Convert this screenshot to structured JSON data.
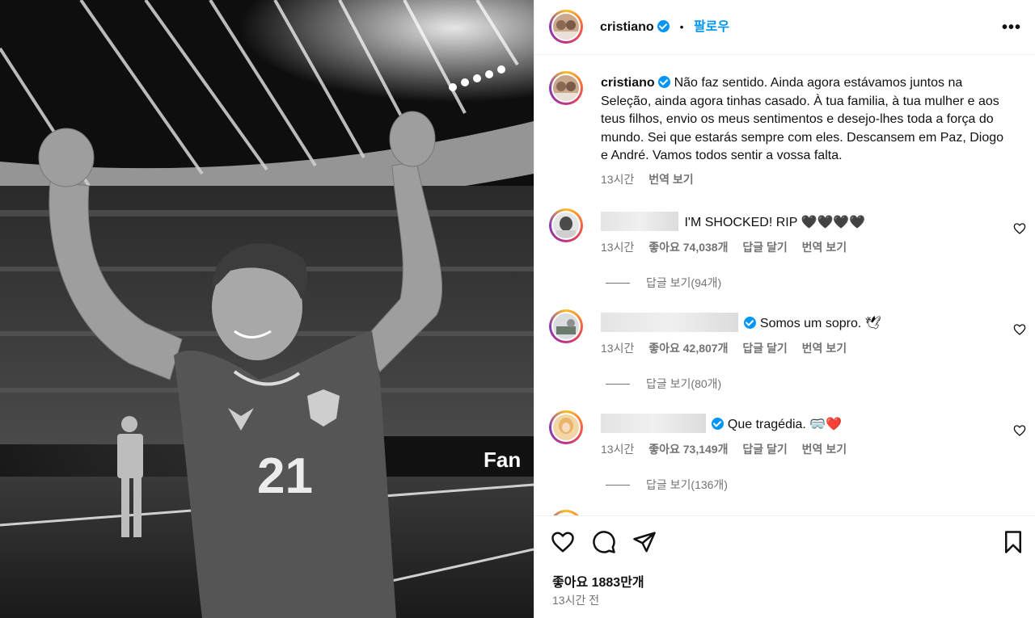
{
  "post": {
    "username": "cristiano",
    "follow_label": "팔로우",
    "dot": "•",
    "more_label": "•••"
  },
  "caption": {
    "username": "cristiano",
    "text": "Não faz sentido. Ainda agora estávamos juntos na Seleção, ainda agora tinhas casado. À tua familia, à tua mulher e aos teus filhos, envio os meus sentimentos e desejo-lhes toda a força do mundo. Sei que estarás sempre com eles. Descansem em Paz, Diogo e André. Vamos todos sentir a vossa falta.",
    "time": "13시간",
    "translate": "번역 보기"
  },
  "comments": [
    {
      "text": "I'M SHOCKED! RIP 🖤🖤🖤🖤",
      "verified": false,
      "time": "13시간",
      "likes": "좋아요 74,038개",
      "reply": "답글 달기",
      "translate": "번역 보기",
      "view_replies": "답글 보기(94개)"
    },
    {
      "text": "Somos um sopro. 🕊",
      "verified": true,
      "time": "13시간",
      "likes": "좋아요 42,807개",
      "reply": "답글 달기",
      "translate": "번역 보기",
      "view_replies": "답글 보기(80개)"
    },
    {
      "text": "Que tragédia. 🥽❤️",
      "verified": true,
      "time": "13시간",
      "likes": "좋아요 73,149개",
      "reply": "답글 달기",
      "translate": "번역 보기",
      "view_replies": "답글 보기(136개)"
    }
  ],
  "footer": {
    "likes": "좋아요 1883만개",
    "time": "13시간 전"
  },
  "photo": {
    "jersey_number": "21",
    "banner_text": "Fan"
  },
  "colors": {
    "accent": "#0095f6",
    "muted": "#737373",
    "divider": "#efefef"
  },
  "icons": [
    "heart-icon",
    "comment-icon",
    "share-icon",
    "bookmark-icon",
    "verified-badge-icon",
    "more-options-icon"
  ]
}
